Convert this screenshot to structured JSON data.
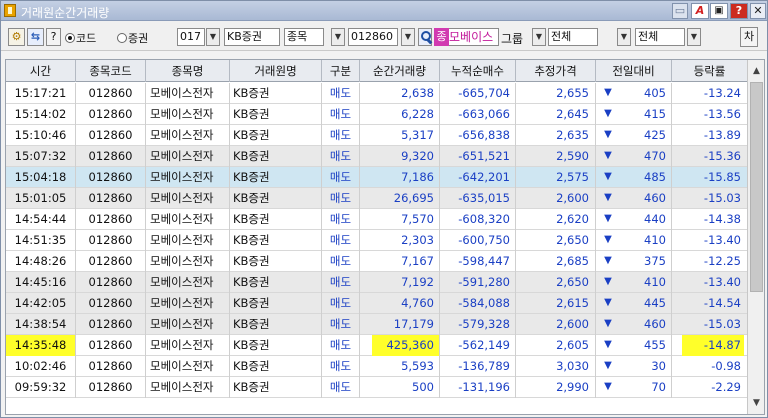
{
  "window": {
    "title": "거래원순간거래량"
  },
  "titlebar_buttons": {
    "a_label": "A",
    "help_label": "?",
    "close_label": "✕"
  },
  "toolbar": {
    "gear_icon": "⚙",
    "swap_icon": "⇆",
    "help_label": "?",
    "radio_code_label": "코드",
    "radio_broker_label": "증권",
    "radio_selected": "코드",
    "broker_code_value": "017",
    "broker_name_value": "KB증권",
    "item_label": "종목",
    "stock_code_value": "012860",
    "stock_badge": "종",
    "stock_name_value": "모베이스",
    "group_label": "그룹",
    "filter1_value": "전체",
    "filter2_value": "전체",
    "chart_button_label": "차"
  },
  "table": {
    "columns": [
      "시간",
      "종목코드",
      "종목명",
      "거래원명",
      "구분",
      "순간거래량",
      "누적순매수",
      "추정가격",
      "전일대비",
      "등락률"
    ],
    "rows": [
      {
        "time": "15:17:21",
        "code": "012860",
        "name": "모베이스전자",
        "broker": "KB증권",
        "side": "매도",
        "net": "2,638",
        "cum": "-665,704",
        "price": "2,655",
        "arrow": "▼",
        "diff": "405",
        "rate": "-13.24"
      },
      {
        "time": "15:14:02",
        "code": "012860",
        "name": "모베이스전자",
        "broker": "KB증권",
        "side": "매도",
        "net": "6,228",
        "cum": "-663,066",
        "price": "2,645",
        "arrow": "▼",
        "diff": "415",
        "rate": "-13.56"
      },
      {
        "time": "15:10:46",
        "code": "012860",
        "name": "모베이스전자",
        "broker": "KB증권",
        "side": "매도",
        "net": "5,317",
        "cum": "-656,838",
        "price": "2,635",
        "arrow": "▼",
        "diff": "425",
        "rate": "-13.89"
      },
      {
        "time": "15:07:32",
        "code": "012860",
        "name": "모베이스전자",
        "broker": "KB증권",
        "side": "매도",
        "net": "9,320",
        "cum": "-651,521",
        "price": "2,590",
        "arrow": "▼",
        "diff": "470",
        "rate": "-15.36"
      },
      {
        "time": "15:04:18",
        "code": "012860",
        "name": "모베이스전자",
        "broker": "KB증권",
        "side": "매도",
        "net": "7,186",
        "cum": "-642,201",
        "price": "2,575",
        "arrow": "▼",
        "diff": "485",
        "rate": "-15.85"
      },
      {
        "time": "15:01:05",
        "code": "012860",
        "name": "모베이스전자",
        "broker": "KB증권",
        "side": "매도",
        "net": "26,695",
        "cum": "-635,015",
        "price": "2,600",
        "arrow": "▼",
        "diff": "460",
        "rate": "-15.03"
      },
      {
        "time": "14:54:44",
        "code": "012860",
        "name": "모베이스전자",
        "broker": "KB증권",
        "side": "매도",
        "net": "7,570",
        "cum": "-608,320",
        "price": "2,620",
        "arrow": "▼",
        "diff": "440",
        "rate": "-14.38"
      },
      {
        "time": "14:51:35",
        "code": "012860",
        "name": "모베이스전자",
        "broker": "KB증권",
        "side": "매도",
        "net": "2,303",
        "cum": "-600,750",
        "price": "2,650",
        "arrow": "▼",
        "diff": "410",
        "rate": "-13.40"
      },
      {
        "time": "14:48:26",
        "code": "012860",
        "name": "모베이스전자",
        "broker": "KB증권",
        "side": "매도",
        "net": "7,167",
        "cum": "-598,447",
        "price": "2,685",
        "arrow": "▼",
        "diff": "375",
        "rate": "-12.25"
      },
      {
        "time": "14:45:16",
        "code": "012860",
        "name": "모베이스전자",
        "broker": "KB증권",
        "side": "매도",
        "net": "7,192",
        "cum": "-591,280",
        "price": "2,650",
        "arrow": "▼",
        "diff": "410",
        "rate": "-13.40"
      },
      {
        "time": "14:42:05",
        "code": "012860",
        "name": "모베이스전자",
        "broker": "KB증권",
        "side": "매도",
        "net": "4,760",
        "cum": "-584,088",
        "price": "2,615",
        "arrow": "▼",
        "diff": "445",
        "rate": "-14.54"
      },
      {
        "time": "14:38:54",
        "code": "012860",
        "name": "모베이스전자",
        "broker": "KB증권",
        "side": "매도",
        "net": "17,179",
        "cum": "-579,328",
        "price": "2,600",
        "arrow": "▼",
        "diff": "460",
        "rate": "-15.03"
      },
      {
        "time": "14:35:48",
        "code": "012860",
        "name": "모베이스전자",
        "broker": "KB증권",
        "side": "매도",
        "net": "425,360",
        "cum": "-562,149",
        "price": "2,605",
        "arrow": "▼",
        "diff": "455",
        "rate": "-14.87"
      },
      {
        "time": "10:02:46",
        "code": "012860",
        "name": "모베이스전자",
        "broker": "KB증권",
        "side": "매도",
        "net": "5,593",
        "cum": "-136,789",
        "price": "3,030",
        "arrow": "▼",
        "diff": "30",
        "rate": "-0.98"
      },
      {
        "time": "09:59:32",
        "code": "012860",
        "name": "모베이스전자",
        "broker": "KB증권",
        "side": "매도",
        "net": "500",
        "cum": "-131,196",
        "price": "2,990",
        "arrow": "▼",
        "diff": "70",
        "rate": "-2.29"
      }
    ]
  },
  "colors": {
    "down": "#1a3fc4",
    "highlight": "#ffff2a",
    "selected_row": "#cfe6f2",
    "alt_row": "#e9e9e9",
    "stock_badge": "#d13ab0"
  },
  "scrollbar": {
    "up_icon": "▲",
    "down_icon": "▼"
  }
}
